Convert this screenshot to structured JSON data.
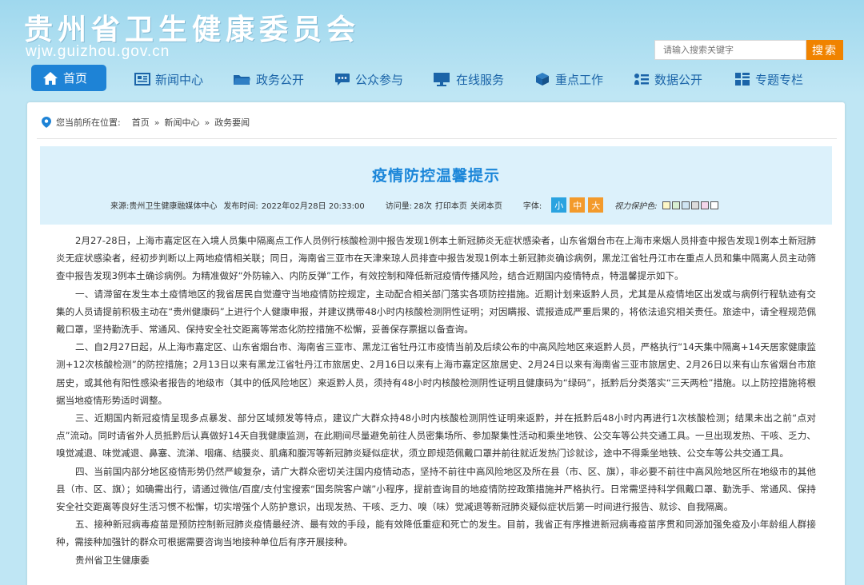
{
  "header": {
    "site_title": "贵州省卫生健康委员会",
    "site_domain": "wjw.guizhou.gov.cn",
    "search_placeholder": "请输入搜索关键字",
    "search_button": "搜索"
  },
  "nav": {
    "items": [
      {
        "label": "首页",
        "icon": "home-icon"
      },
      {
        "label": "新闻中心",
        "icon": "newspaper-icon"
      },
      {
        "label": "政务公开",
        "icon": "folder-icon"
      },
      {
        "label": "公众参与",
        "icon": "chat-icon"
      },
      {
        "label": "在线服务",
        "icon": "monitor-icon"
      },
      {
        "label": "重点工作",
        "icon": "cube-icon"
      },
      {
        "label": "数据公开",
        "icon": "list-icon"
      },
      {
        "label": "专题专栏",
        "icon": "grid-icon"
      }
    ]
  },
  "breadcrumb": {
    "prefix": "您当前所在位置:",
    "items": [
      "首页",
      "新闻中心",
      "政务要闻"
    ],
    "separator": "»"
  },
  "article": {
    "title": "疫情防控温馨提示",
    "source_label": "来源:",
    "source": "贵州卫生健康融媒体中心",
    "date_label": "发布时间:",
    "date": "2022年02月28日 20:33:00",
    "views_label": "访问量:",
    "views": "28次",
    "print": "打印本页",
    "close": "关闭本页",
    "font_label": "字体:",
    "font_sizes": [
      "小",
      "中",
      "大"
    ],
    "vision_label": "视力保护色:",
    "vision_colors": [
      "#fdf7c6",
      "#d8efd2",
      "#cfe5f3",
      "#dcdcdc",
      "#f4d6ea",
      "#ffffff"
    ],
    "paragraphs": [
      "2月27-28日，上海市嘉定区在入境人员集中隔离点工作人员例行核酸检测中报告发现1例本土新冠肺炎无症状感染者，山东省烟台市在上海市来烟人员排查中报告发现1例本土新冠肺炎无症状感染者，经初步判断以上两地疫情相关联；同日，海南省三亚市在天津来琼人员排查中报告发现1例本土新冠肺炎确诊病例，黑龙江省牡丹江市在重点人员和集中隔离人员主动筛查中报告发现3例本土确诊病例。为精准做好“外防输入、内防反弹”工作，有效控制和降低新冠疫情传播风险，结合近期国内疫情特点，特温馨提示如下。",
      "一、请滞留在发生本土疫情地区的我省居民自觉遵守当地疫情防控规定，主动配合相关部门落实各项防控措施。近期计划来返黔人员，尤其是从疫情地区出发或与病例行程轨迹有交集的人员请提前积极主动在“贵州健康码”上进行个人健康申报，并建议携带48小时内核酸检测阴性证明；对因瞒报、谎报造成严重后果的，将依法追究相关责任。旅途中，请全程规范佩戴口罩，坚持勤洗手、常通风、保持安全社交距离等常态化防控措施不松懈，妥善保存票据以备查询。",
      "二、自2月27日起，从上海市嘉定区、山东省烟台市、海南省三亚市、黑龙江省牡丹江市疫情当前及后续公布的中高风险地区来返黔人员，严格执行“14天集中隔离+14天居家健康监测+12次核酸检测”的防控措施；2月13日以来有黑龙江省牡丹江市旅居史、2月16日以来有上海市嘉定区旅居史、2月24日以来有海南省三亚市旅居史、2月26日以来有山东省烟台市旅居史，或其他有阳性感染者报告的地级市（其中的低风险地区）来返黔人员，须持有48小时内核酸检测阴性证明且健康码为“绿码”，抵黔后分类落实“三天两检”措施。以上防控措施将根据当地疫情形势适时调整。",
      "三、近期国内新冠疫情呈现多点暴发、部分区域频发等特点，建议广大群众持48小时内核酸检测阴性证明来返黔，并在抵黔后48小时内再进行1次核酸检测；结果未出之前“点对点”流动。同时请省外人员抵黔后认真做好14天自我健康监测，在此期间尽量避免前往人员密集场所、参加聚集性活动和乘坐地铁、公交车等公共交通工具。一旦出现发热、干咳、乏力、嗅觉减退、味觉减退、鼻塞、流涕、咽痛、结膜炎、肌痛和腹泻等新冠肺炎疑似症状，须立即规范佩戴口罩并前往就近发热门诊就诊，途中不得乘坐地铁、公交车等公共交通工具。",
      "四、当前国内部分地区疫情形势仍然严峻复杂，请广大群众密切关注国内疫情动态，坚持不前往中高风险地区及所在县（市、区、旗），非必要不前往中高风险地区所在地级市的其他县（市、区、旗）；如确需出行，请通过微信/百度/支付宝搜索“国务院客户端”小程序，提前查询目的地疫情防控政策措施并严格执行。日常需坚持科学佩戴口罩、勤洗手、常通风、保持安全社交距离等良好生活习惯不松懈，切实增强个人防护意识，出现发热、干咳、乏力、嗅（味）觉减退等新冠肺炎疑似症状后第一时间进行报告、就诊、自我隔离。",
      "五、接种新冠病毒疫苗是预防控制新冠肺炎疫情最经济、最有效的手段，能有效降低重症和死亡的发生。目前，我省正有序推进新冠病毒疫苗序贯和同源加强免疫及小年龄组人群接种，需接种加强针的群众可根据需要咨询当地接种单位后有序开展接种。"
    ],
    "signoff": "贵州省卫生健康委"
  },
  "colors": {
    "brand_blue": "#1e83d6",
    "title_blue": "#1b86d9",
    "accent_orange": "#f08300",
    "nav_text": "#1b64a8"
  }
}
